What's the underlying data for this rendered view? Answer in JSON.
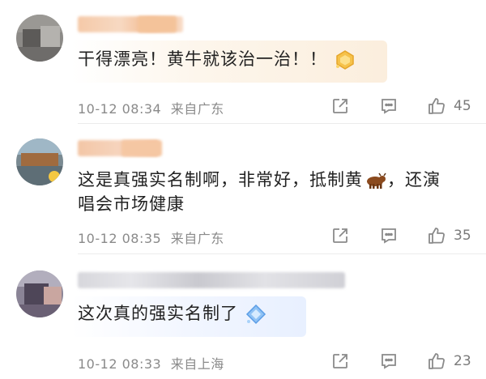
{
  "comments": [
    {
      "text": "干得漂亮！黄牛就该治一治！！",
      "time": "10-12 08:34",
      "location": "来自广东",
      "likes": "45",
      "emoji": "gem-emoji-gold"
    },
    {
      "text_part1": "这是真强实名制啊，非常好，抵制黄",
      "text_part2": "，还演唱会市场健康",
      "emoji": "bull-emoji",
      "time": "10-12 08:35",
      "location": "来自广东",
      "likes": "35"
    },
    {
      "text": "这次真的强实名制了",
      "time": "10-12 08:33",
      "location": "来自上海",
      "likes": "23",
      "emoji": "gem-emoji-blue"
    }
  ],
  "icons": {
    "share": "share-icon",
    "reply": "reply-icon",
    "like": "thumbs-up-icon"
  },
  "colors": {
    "text": "#222222",
    "meta": "#8a8a8a",
    "icon": "#8a8a8a",
    "divider": "#ececec"
  }
}
